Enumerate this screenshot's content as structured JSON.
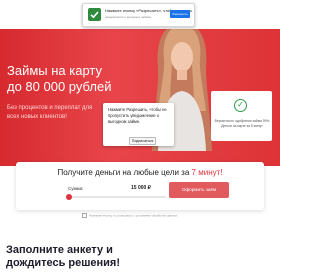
{
  "notification": {
    "title": "Нажмите кнопку «Разрешить», чтобы получать",
    "subtitle": "уведомления о выгодных займах",
    "allow_label": "Разрешить"
  },
  "hero": {
    "title": "Займы на карту до 80 000 рублей",
    "subtitle": "Без процентов и переплат для всех новых клиентов!",
    "popup_text": "Нажмите Разрешить, чтобы не пропустить уведомление о выгодном займе.",
    "popup_button": "Подписаться",
    "widget_text": "Вероятность одобрения займа 99% Деньги на карте за 5 минут"
  },
  "form": {
    "title_prefix": "Получите деньги на любые цели за",
    "title_highlight": "7 минут!",
    "amount_label": "Сумма:",
    "amount_value": "15 000 ₽",
    "submit_label": "Оформить заём",
    "slider_fraction": 0.0,
    "disclaimer": "Нажимая кнопку, я соглашаюсь с условиями обработки данных"
  },
  "section": {
    "title": "Заполните анкету и дождитесь решения!"
  },
  "colors": {
    "brand_red": "#e0323a",
    "hero_bg": "#d62a2f",
    "notif_green": "#2e8b3e",
    "notif_blue": "#1a73e8"
  }
}
